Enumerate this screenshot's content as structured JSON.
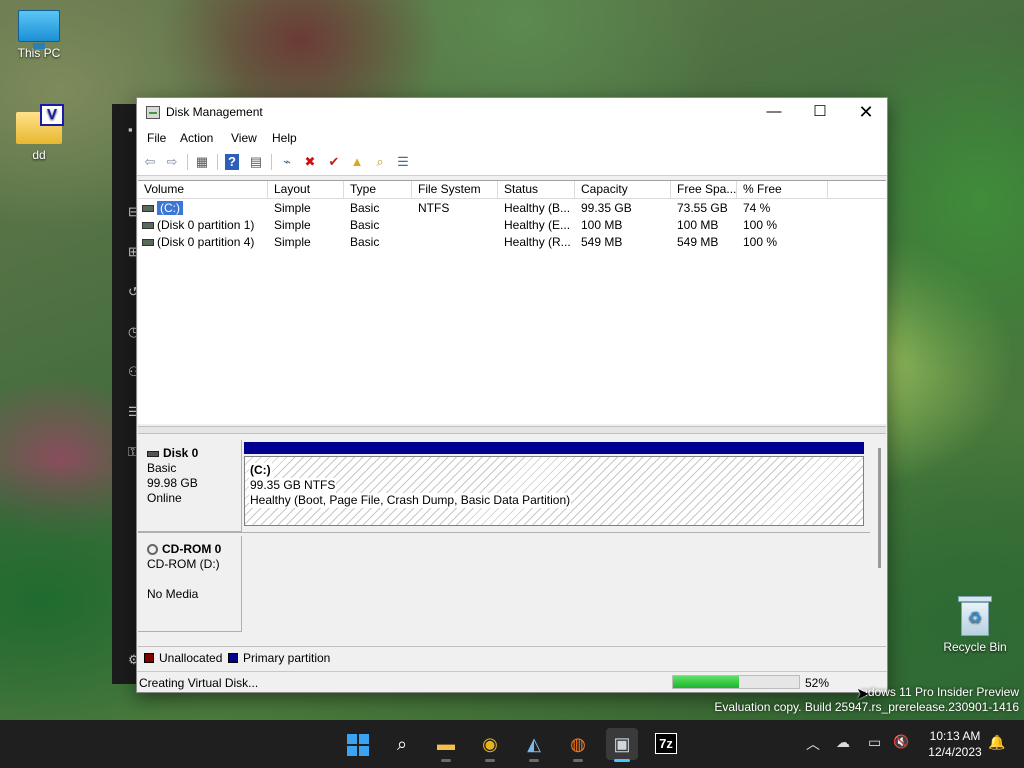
{
  "desktop": {
    "icons": [
      {
        "label": "This PC",
        "icon": "monitor-icon"
      },
      {
        "label": "dd",
        "icon": "folder-icon",
        "badge": "V"
      },
      {
        "label": "Recycle Bin",
        "icon": "recycle-bin-icon"
      }
    ],
    "watermark": {
      "line1": "ndows 11 Pro Insider Preview",
      "line2": "Evaluation copy. Build 25947.rs_prerelease.230901-1416"
    }
  },
  "window": {
    "title": "Disk Management",
    "controls": {
      "minimize": "—",
      "maximize": "☐",
      "close": "✕"
    },
    "menu": [
      "File",
      "Action",
      "View",
      "Help"
    ],
    "toolbar": [
      {
        "icon": "back-arrow-icon",
        "glyph": "⇦"
      },
      {
        "icon": "forward-arrow-icon",
        "glyph": "⇨"
      },
      {
        "icon": "show-hide-console-tree-icon",
        "glyph": "▦"
      },
      {
        "icon": "help-icon",
        "glyph": "?"
      },
      {
        "icon": "show-hide-action-pane-icon",
        "glyph": "▤"
      },
      {
        "icon": "connect-disk-icon",
        "glyph": "⌁"
      },
      {
        "icon": "delete-icon",
        "glyph": "✖"
      },
      {
        "icon": "check-icon",
        "glyph": "✔"
      },
      {
        "icon": "folder-up-icon",
        "glyph": "▲"
      },
      {
        "icon": "search-folder-icon",
        "glyph": "⌕"
      },
      {
        "icon": "properties-icon",
        "glyph": "☰"
      }
    ]
  },
  "volume_list": {
    "columns": [
      "Volume",
      "Layout",
      "Type",
      "File System",
      "Status",
      "Capacity",
      "Free Spa...",
      "% Free"
    ],
    "rows": [
      {
        "volume": "(C:)",
        "layout": "Simple",
        "type": "Basic",
        "fs": "NTFS",
        "status": "Healthy (B...",
        "capacity": "99.35 GB",
        "free": "73.55 GB",
        "pct_free": "74 %",
        "selected": true
      },
      {
        "volume": "(Disk 0 partition 1)",
        "layout": "Simple",
        "type": "Basic",
        "fs": "",
        "status": "Healthy (E...",
        "capacity": "100 MB",
        "free": "100 MB",
        "pct_free": "100 %",
        "selected": false
      },
      {
        "volume": "(Disk 0 partition 4)",
        "layout": "Simple",
        "type": "Basic",
        "fs": "",
        "status": "Healthy (R...",
        "capacity": "549 MB",
        "free": "549 MB",
        "pct_free": "100 %",
        "selected": false
      }
    ]
  },
  "disks": {
    "disk0": {
      "name": "Disk 0",
      "type": "Basic",
      "size": "99.98 GB",
      "state": "Online",
      "partition": {
        "name": "(C:)",
        "size_fs": "99.35 GB NTFS",
        "status": "Healthy (Boot, Page File, Crash Dump, Basic Data Partition)"
      }
    },
    "cdrom0": {
      "name": "CD-ROM 0",
      "type": "CD-ROM (D:)",
      "media": "No Media"
    }
  },
  "legend": [
    {
      "label": "Unallocated",
      "color": "#800000"
    },
    {
      "label": "Primary partition",
      "color": "#000090"
    }
  ],
  "status_bar": {
    "text": "Creating Virtual Disk...",
    "progress": 52,
    "progress_label": "52%"
  },
  "taskbar": {
    "apps": [
      {
        "name": "start",
        "icon": "windows-start-icon"
      },
      {
        "name": "search",
        "icon": "search-icon",
        "glyph": "⌕"
      },
      {
        "name": "file-explorer",
        "icon": "file-explorer-icon",
        "glyph": "▬"
      },
      {
        "name": "chrome",
        "icon": "chrome-icon",
        "glyph": "◉"
      },
      {
        "name": "resource-monitor",
        "icon": "monitor-chart-icon",
        "glyph": "◭"
      },
      {
        "name": "firefox",
        "icon": "firefox-icon",
        "glyph": "◍"
      },
      {
        "name": "disk-management",
        "icon": "disk-management-icon",
        "glyph": "▣"
      },
      {
        "name": "7zip",
        "icon": "7zip-icon",
        "glyph": "7z"
      }
    ],
    "tray": [
      {
        "icon": "chevron-up-icon",
        "glyph": "︿"
      },
      {
        "icon": "onedrive-icon",
        "glyph": "☁"
      },
      {
        "icon": "network-icon",
        "glyph": "▭"
      },
      {
        "icon": "volume-muted-icon",
        "glyph": "🔇"
      }
    ],
    "clock": {
      "time": "10:13 AM",
      "date": "12/4/2023"
    },
    "notification": {
      "icon": "bell-icon",
      "glyph": "🔔"
    }
  },
  "colors": {
    "selection": "#3b77d6",
    "primary_partition": "#000090",
    "progress": "#1fb42b"
  }
}
